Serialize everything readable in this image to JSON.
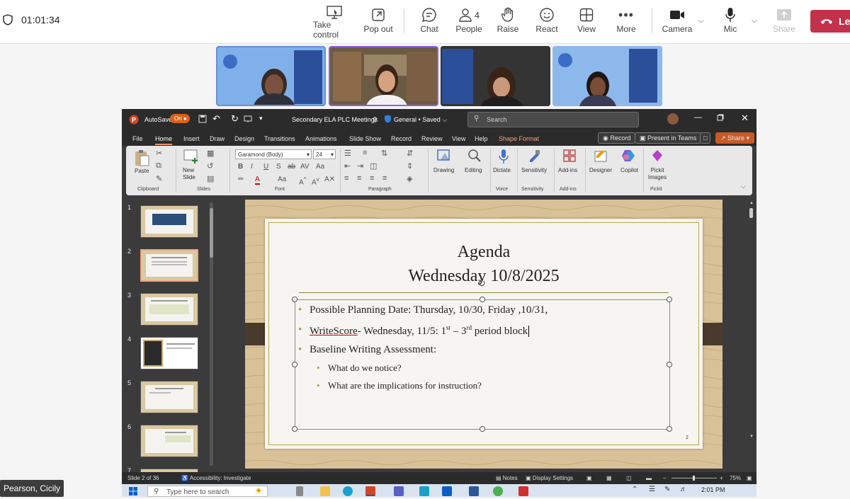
{
  "teams": {
    "timer": "01:01:34",
    "toolbar": [
      {
        "label": "Take control",
        "icon": "take-control-icon"
      },
      {
        "label": "Pop out",
        "icon": "pop-out-icon"
      },
      {
        "label": "Chat",
        "icon": "chat-icon"
      },
      {
        "label": "People",
        "icon": "people-icon",
        "badge": "4"
      },
      {
        "label": "Raise",
        "icon": "raise-hand-icon"
      },
      {
        "label": "React",
        "icon": "react-icon"
      },
      {
        "label": "View",
        "icon": "view-icon"
      },
      {
        "label": "More",
        "icon": "more-icon"
      },
      {
        "label": "Camera",
        "icon": "camera-icon"
      },
      {
        "label": "Mic",
        "icon": "mic-icon"
      },
      {
        "label": "Share",
        "icon": "share-icon"
      }
    ],
    "leave_label": "Le",
    "presenter_name": "Pearson, Cicily"
  },
  "ppt": {
    "autosave_label": "AutoSave",
    "autosave_state": "On",
    "doc_title": "Secondary ELA PLC Meetings",
    "sensitivity": "General",
    "saved": "Saved",
    "search_placeholder": "Search",
    "menu": [
      "File",
      "Home",
      "Insert",
      "Draw",
      "Design",
      "Transitions",
      "Animations",
      "Slide Show",
      "Record",
      "Review",
      "View",
      "Help",
      "Shape Format"
    ],
    "record_btn": "Record",
    "present_btn": "Present in Teams",
    "share_btn": "Share",
    "ribbon": {
      "paste": "Paste",
      "new_slide": "New Slide",
      "font_name": "Garamond (Body)",
      "font_size": "24",
      "drawing": "Drawing",
      "editing": "Editing",
      "dictate": "Dictate",
      "sensitivity": "Sensitivity",
      "add_ins": "Add-ins",
      "designer": "Designer",
      "copilot": "Copilot",
      "pickit": "Pickit Images",
      "groups": {
        "clipboard": "Clipboard",
        "slides": "Slides",
        "font": "Font",
        "paragraph": "Paragraph",
        "voice": "Voice",
        "sensitivity": "Sensitivity",
        "addins": "Add-ins",
        "pickit": "Pickit"
      }
    },
    "thumb_numbers": [
      "1",
      "2",
      "3",
      "4",
      "5",
      "6",
      "7"
    ],
    "slide": {
      "title_line1": "Agenda",
      "title_line2": "Wednesday 10/8/2025",
      "bullets": [
        "Possible Planning Date: Thursday, 10/30, Friday ,10/31,",
        "WriteScore- Wednesday, 11/5: 1st – 3rd period block",
        "Baseline Writing Assessment:"
      ],
      "bullet2_parts": {
        "a": "WriteScore",
        "b": "- Wednesday, 11/5: 1",
        "sup1": "st",
        "c": " – 3",
        "sup2": "rd",
        "d": " period block"
      },
      "sub_bullets": [
        "What do we notice?",
        "What are the implications for instruction?"
      ],
      "page_number": "2"
    },
    "status": {
      "slide_of": "Slide 2 of 36",
      "accessibility": "Accessibility: Investigate",
      "notes": "Notes",
      "display": "Display Settings",
      "zoom": "75%"
    }
  },
  "taskbar": {
    "search_placeholder": "Type here to search",
    "time": "2:01 PM"
  }
}
